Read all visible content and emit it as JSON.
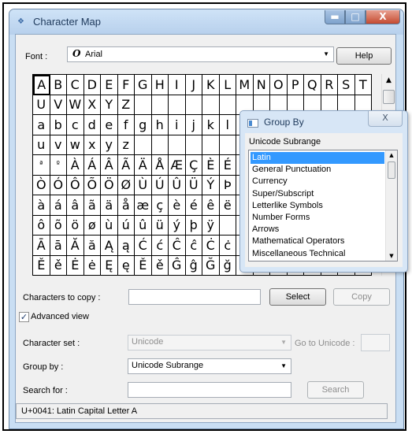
{
  "window": {
    "title": "Character Map",
    "controls": {
      "minimize": "▬",
      "maximize": "□",
      "close": "X"
    }
  },
  "font": {
    "label": "Font :",
    "glyph": "O",
    "value": "Arial",
    "help_label": "Help"
  },
  "grid": {
    "rows": [
      [
        "A",
        "B",
        "C",
        "D",
        "E",
        "F",
        "G",
        "H",
        "I",
        "J",
        "K",
        "L",
        "M",
        "N",
        "O",
        "P",
        "Q",
        "R",
        "S",
        "T"
      ],
      [
        "U",
        "V",
        "W",
        "X",
        "Y",
        "Z",
        "",
        "",
        "",
        "",
        "",
        "",
        "",
        "",
        "",
        "",
        "",
        "",
        "",
        ""
      ],
      [
        "a",
        "b",
        "c",
        "d",
        "e",
        "f",
        "g",
        "h",
        "i",
        "j",
        "k",
        "l",
        "",
        "",
        "",
        "",
        "",
        "",
        "",
        ""
      ],
      [
        "u",
        "v",
        "w",
        "x",
        "y",
        "z",
        "",
        "",
        "",
        "",
        "",
        "",
        "",
        "",
        "",
        "",
        "",
        "",
        "",
        ""
      ],
      [
        "ª",
        "º",
        "À",
        "Á",
        "Â",
        "Ã",
        "Ä",
        "Å",
        "Æ",
        "Ç",
        "È",
        "É",
        "",
        "",
        "",
        "",
        "",
        "",
        "",
        ""
      ],
      [
        "Ò",
        "Ó",
        "Ô",
        "Õ",
        "Ö",
        "Ø",
        "Ù",
        "Ú",
        "Û",
        "Ü",
        "Ý",
        "Þ",
        "",
        "",
        "",
        "",
        "",
        "",
        "",
        ""
      ],
      [
        "à",
        "á",
        "â",
        "ã",
        "ä",
        "å",
        "æ",
        "ç",
        "è",
        "é",
        "ê",
        "ë",
        "",
        "",
        "",
        "",
        "",
        "",
        "",
        ""
      ],
      [
        "ô",
        "õ",
        "ö",
        "ø",
        "ù",
        "ú",
        "û",
        "ü",
        "ý",
        "þ",
        "ÿ",
        "",
        "",
        "",
        "",
        "",
        "",
        "",
        "",
        ""
      ],
      [
        "Ā",
        "ā",
        "Ă",
        "ă",
        "Ą",
        "ą",
        "Ć",
        "ć",
        "Ĉ",
        "ĉ",
        "Ċ",
        "ċ",
        "",
        "",
        "",
        "",
        "",
        "",
        "",
        ""
      ],
      [
        "Ě",
        "ě",
        "Ė",
        "ė",
        "Ę",
        "ę",
        "Ě",
        "ě",
        "Ĝ",
        "ĝ",
        "Ğ",
        "ğ",
        "",
        "",
        "",
        "",
        "",
        "",
        "",
        ""
      ]
    ]
  },
  "group_by_popup": {
    "title": "Group By",
    "close_label": "X",
    "list_label": "Unicode Subrange",
    "items": [
      "Latin",
      "General Punctuation",
      "Currency",
      "Super/Subscript",
      "Letterlike Symbols",
      "Number Forms",
      "Arrows",
      "Mathematical Operators",
      "Miscellaneous Technical"
    ],
    "selected_item": "Latin"
  },
  "copy": {
    "label": "Characters to copy :",
    "value": "",
    "select_label": "Select",
    "copy_label": "Copy"
  },
  "advanced": {
    "label": "Advanced view",
    "checked": true,
    "check_glyph": "✓"
  },
  "charset": {
    "label": "Character set :",
    "value": "Unicode",
    "goto_label": "Go to Unicode :"
  },
  "groupby": {
    "label": "Group by :",
    "value": "Unicode Subrange"
  },
  "search": {
    "label": "Search for :",
    "value": "",
    "button_label": "Search"
  },
  "status": {
    "text": "U+0041: Latin Capital Letter A"
  },
  "icons": {
    "dropdown": "▼",
    "scroll_up": "▲",
    "scroll_down": "▼"
  }
}
